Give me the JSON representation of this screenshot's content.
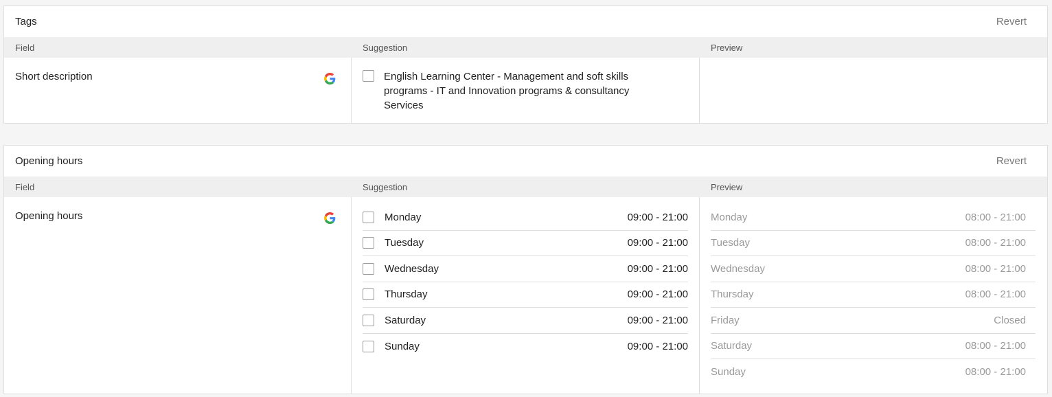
{
  "tags_card": {
    "title": "Tags",
    "revert_label": "Revert",
    "columns": [
      "Field",
      "Suggestion",
      "Preview"
    ],
    "field_label": "Short description",
    "suggestion_text": "English Learning Center - Management and soft skills programs - IT and Innovation programs & consultancy Services"
  },
  "hours_card": {
    "title": "Opening hours",
    "revert_label": "Revert",
    "columns": [
      "Field",
      "Suggestion",
      "Preview"
    ],
    "field_label": "Opening hours",
    "suggestion_rows": [
      {
        "day": "Monday",
        "time": "09:00 - 21:00"
      },
      {
        "day": "Tuesday",
        "time": "09:00 - 21:00"
      },
      {
        "day": "Wednesday",
        "time": "09:00 - 21:00"
      },
      {
        "day": "Thursday",
        "time": "09:00 - 21:00"
      },
      {
        "day": "Saturday",
        "time": "09:00 - 21:00"
      },
      {
        "day": "Sunday",
        "time": "09:00 - 21:00"
      }
    ],
    "preview_rows": [
      {
        "day": "Monday",
        "time": "08:00 - 21:00"
      },
      {
        "day": "Tuesday",
        "time": "08:00 - 21:00"
      },
      {
        "day": "Wednesday",
        "time": "08:00 - 21:00"
      },
      {
        "day": "Thursday",
        "time": "08:00 - 21:00"
      },
      {
        "day": "Friday",
        "time": "Closed"
      },
      {
        "day": "Saturday",
        "time": "08:00 - 21:00"
      },
      {
        "day": "Sunday",
        "time": "08:00 - 21:00"
      }
    ]
  },
  "icons": {
    "source": "google-icon"
  },
  "colors": {
    "google_blue": "#4285F4",
    "google_red": "#EA4335",
    "google_yellow": "#FBBC05",
    "google_green": "#34A853"
  }
}
